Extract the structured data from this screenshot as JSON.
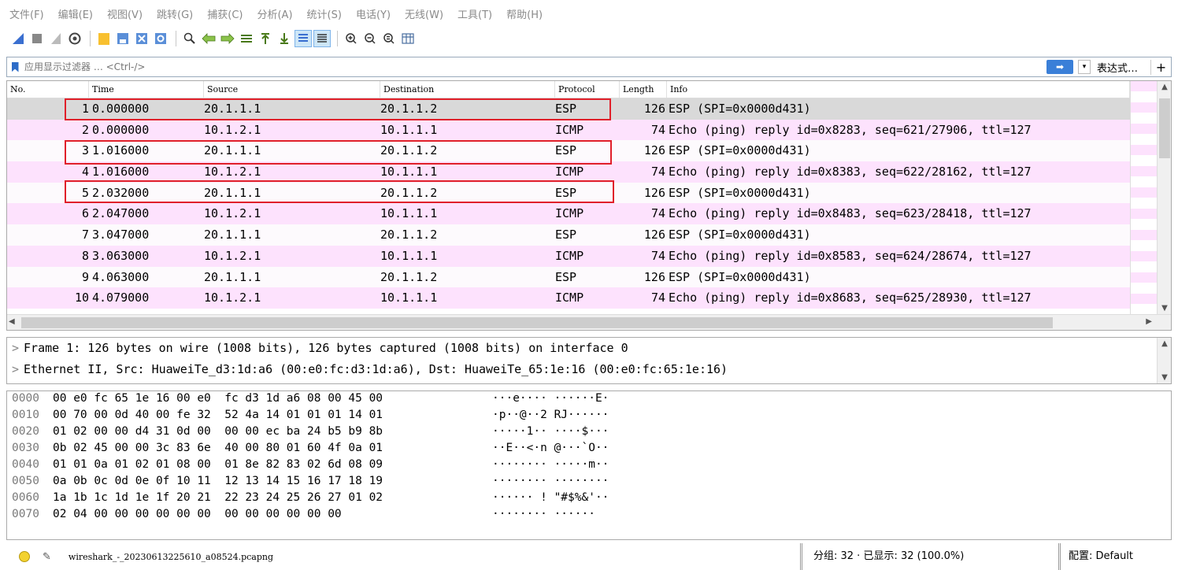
{
  "menu": [
    "文件(F)",
    "编辑(E)",
    "视图(V)",
    "跳转(G)",
    "捕获(C)",
    "分析(A)",
    "统计(S)",
    "电话(Y)",
    "无线(W)",
    "工具(T)",
    "帮助(H)"
  ],
  "filter": {
    "placeholder": "应用显示过滤器 … <Ctrl-/>",
    "apply_glyph": "➡",
    "dropdown_glyph": "▾",
    "expression_label": "表达式…",
    "add_glyph": "+"
  },
  "columns": {
    "no": "No.",
    "time": "Time",
    "source": "Source",
    "destination": "Destination",
    "protocol": "Protocol",
    "length": "Length",
    "info": "Info"
  },
  "packets": [
    {
      "no": "1",
      "time": "0.000000",
      "src": "20.1.1.1",
      "dst": "20.1.1.2",
      "proto": "ESP",
      "len": "126",
      "info": "ESP (SPI=0x0000d431)"
    },
    {
      "no": "2",
      "time": "0.000000",
      "src": "10.1.2.1",
      "dst": "10.1.1.1",
      "proto": "ICMP",
      "len": "74",
      "info": "Echo (ping) reply    id=0x8283, seq=621/27906, ttl=127"
    },
    {
      "no": "3",
      "time": "1.016000",
      "src": "20.1.1.1",
      "dst": "20.1.1.2",
      "proto": "ESP",
      "len": "126",
      "info": "ESP (SPI=0x0000d431)"
    },
    {
      "no": "4",
      "time": "1.016000",
      "src": "10.1.2.1",
      "dst": "10.1.1.1",
      "proto": "ICMP",
      "len": "74",
      "info": "Echo (ping) reply    id=0x8383, seq=622/28162, ttl=127"
    },
    {
      "no": "5",
      "time": "2.032000",
      "src": "20.1.1.1",
      "dst": "20.1.1.2",
      "proto": "ESP",
      "len": "126",
      "info": "ESP (SPI=0x0000d431)"
    },
    {
      "no": "6",
      "time": "2.047000",
      "src": "10.1.2.1",
      "dst": "10.1.1.1",
      "proto": "ICMP",
      "len": "74",
      "info": "Echo (ping) reply    id=0x8483, seq=623/28418, ttl=127"
    },
    {
      "no": "7",
      "time": "3.047000",
      "src": "20.1.1.1",
      "dst": "20.1.1.2",
      "proto": "ESP",
      "len": "126",
      "info": "ESP (SPI=0x0000d431)"
    },
    {
      "no": "8",
      "time": "3.063000",
      "src": "10.1.2.1",
      "dst": "10.1.1.1",
      "proto": "ICMP",
      "len": "74",
      "info": "Echo (ping) reply    id=0x8583, seq=624/28674, ttl=127"
    },
    {
      "no": "9",
      "time": "4.063000",
      "src": "20.1.1.1",
      "dst": "20.1.1.2",
      "proto": "ESP",
      "len": "126",
      "info": "ESP (SPI=0x0000d431)"
    },
    {
      "no": "10",
      "time": "4.079000",
      "src": "10.1.2.1",
      "dst": "10.1.1.1",
      "proto": "ICMP",
      "len": "74",
      "info": "Echo (ping) reply    id=0x8683, seq=625/28930, ttl=127"
    }
  ],
  "details": [
    "Frame 1: 126 bytes on wire (1008 bits), 126 bytes captured (1008 bits) on interface 0",
    "Ethernet II, Src: HuaweiTe_d3:1d:a6 (00:e0:fc:d3:1d:a6), Dst: HuaweiTe_65:1e:16 (00:e0:fc:65:1e:16)"
  ],
  "bytes": [
    {
      "offset": "0000",
      "hex": "00 e0 fc 65 1e 16 00 e0  fc d3 1d a6 08 00 45 00",
      "ascii": "···e···· ······E·"
    },
    {
      "offset": "0010",
      "hex": "00 70 00 0d 40 00 fe 32  52 4a 14 01 01 01 14 01",
      "ascii": "·p··@··2 RJ······"
    },
    {
      "offset": "0020",
      "hex": "01 02 00 00 d4 31 0d 00  00 00 ec ba 24 b5 b9 8b",
      "ascii": "·····1·· ····$···"
    },
    {
      "offset": "0030",
      "hex": "0b 02 45 00 00 3c 83 6e  40 00 80 01 60 4f 0a 01",
      "ascii": "··E··<·n @···`O··"
    },
    {
      "offset": "0040",
      "hex": "01 01 0a 01 02 01 08 00  01 8e 82 83 02 6d 08 09",
      "ascii": "········ ·····m··"
    },
    {
      "offset": "0050",
      "hex": "0a 0b 0c 0d 0e 0f 10 11  12 13 14 15 16 17 18 19",
      "ascii": "········ ········"
    },
    {
      "offset": "0060",
      "hex": "1a 1b 1c 1d 1e 1f 20 21  22 23 24 25 26 27 01 02",
      "ascii": "······ ! \"#$%&'··"
    },
    {
      "offset": "0070",
      "hex": "02 04 00 00 00 00 00 00  00 00 00 00 00 00",
      "ascii": "········ ······"
    }
  ],
  "status": {
    "file": "wireshark_-_20230613225610_a08524.pcapng",
    "stats": "分组: 32 · 已显示: 32 (100.0%)",
    "profile": "配置: Default"
  }
}
